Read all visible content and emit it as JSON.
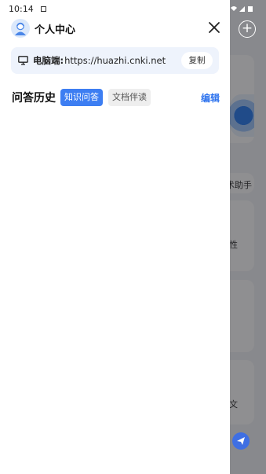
{
  "status_bar": {
    "time": "10:14"
  },
  "header": {
    "title": "个人中心",
    "avatar_icon": "user-avatar-icon",
    "close_icon": "close-icon"
  },
  "pc_access": {
    "label": "电脑端:",
    "url": "https://huazhi.cnki.net",
    "copy_label": "复制",
    "icon": "monitor-icon"
  },
  "history": {
    "title": "问答历史",
    "tabs": [
      {
        "label": "知识问答",
        "active": true
      },
      {
        "label": "文档伴读",
        "active": false
      }
    ],
    "edit_label": "编辑"
  },
  "background": {
    "fragments": [
      "术助手",
      "性",
      "文"
    ]
  },
  "colors": {
    "accent": "#3d7ef2",
    "pc_bar_bg": "#eef3fc",
    "tab_inactive_bg": "#eeeeee"
  }
}
